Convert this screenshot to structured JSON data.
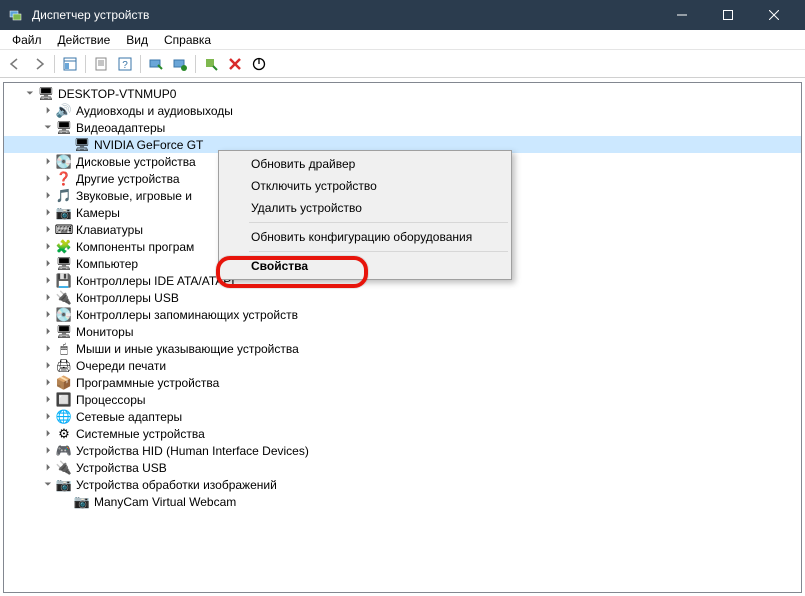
{
  "titlebar": {
    "title": "Диспетчер устройств"
  },
  "menubar": {
    "file": "Файл",
    "action": "Действие",
    "view": "Вид",
    "help": "Справка"
  },
  "tree": {
    "root": "DESKTOP-VTNMUP0",
    "nodes": [
      {
        "label": "Аудиовходы и аудиовыходы",
        "icon": "🔊"
      },
      {
        "label": "Видеоадаптеры",
        "icon": "🖥",
        "expanded": true,
        "children": [
          {
            "label": "NVIDIA GeForce GT",
            "icon": "🖥",
            "selected": true
          }
        ]
      },
      {
        "label": "Дисковые устройства",
        "icon": "💽"
      },
      {
        "label": "Другие устройства",
        "icon": "❓"
      },
      {
        "label": "Звуковые, игровые и",
        "icon": "🎵"
      },
      {
        "label": "Камеры",
        "icon": "📷"
      },
      {
        "label": "Клавиатуры",
        "icon": "⌨"
      },
      {
        "label": "Компоненты програм",
        "icon": "🧩"
      },
      {
        "label": "Компьютер",
        "icon": "🖥"
      },
      {
        "label": "Контроллеры IDE ATA/ATAPI",
        "icon": "💾"
      },
      {
        "label": "Контроллеры USB",
        "icon": "🔌"
      },
      {
        "label": "Контроллеры запоминающих устройств",
        "icon": "💽"
      },
      {
        "label": "Мониторы",
        "icon": "🖥"
      },
      {
        "label": "Мыши и иные указывающие устройства",
        "icon": "🖱"
      },
      {
        "label": "Очереди печати",
        "icon": "🖨"
      },
      {
        "label": "Программные устройства",
        "icon": "📦"
      },
      {
        "label": "Процессоры",
        "icon": "🔲"
      },
      {
        "label": "Сетевые адаптеры",
        "icon": "🌐"
      },
      {
        "label": "Системные устройства",
        "icon": "⚙"
      },
      {
        "label": "Устройства HID (Human Interface Devices)",
        "icon": "🎮"
      },
      {
        "label": "Устройства USB",
        "icon": "🔌"
      },
      {
        "label": "Устройства обработки изображений",
        "icon": "📷",
        "expanded": true,
        "children": [
          {
            "label": "ManyCam Virtual Webcam",
            "icon": "📷"
          }
        ]
      }
    ]
  },
  "context_menu": {
    "update_driver": "Обновить драйвер",
    "disable_device": "Отключить устройство",
    "uninstall_device": "Удалить устройство",
    "scan_hardware": "Обновить конфигурацию оборудования",
    "properties": "Свойства"
  }
}
